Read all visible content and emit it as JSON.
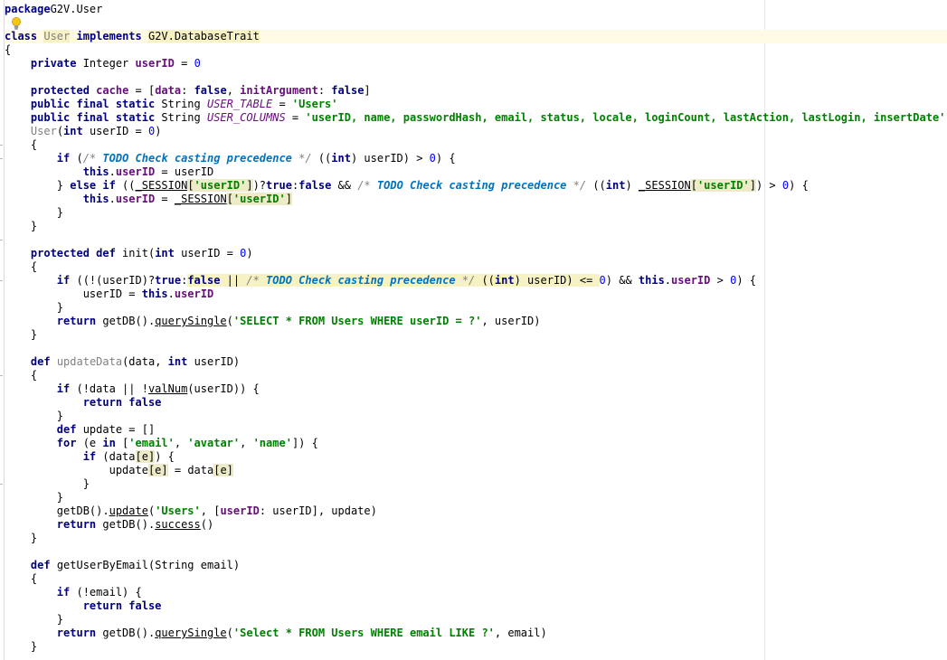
{
  "editor": {
    "language": "groovy",
    "colors": {
      "keyword": "#000080",
      "string": "#008000",
      "number": "#0000ff",
      "field": "#660e7a",
      "comment": "#808080",
      "todo": "#0073bf",
      "caret_line": "#fffae3",
      "highlight": "#edebc8"
    },
    "intention_icon": "lightbulb-icon",
    "lines": [
      [
        [
          "kw",
          "package"
        ],
        [
          "",
          "G2V.User"
        ]
      ],
      [],
      [
        [
          "kw",
          "class"
        ],
        [
          "",
          " "
        ],
        [
          "unu hlg",
          "User"
        ],
        [
          "",
          " "
        ],
        [
          "kw",
          "implements"
        ],
        [
          "",
          " "
        ],
        [
          "hlg",
          "G2V.DatabaseTrait"
        ]
      ],
      [
        [
          "",
          "{"
        ]
      ],
      [
        [
          "",
          "    "
        ],
        [
          "kw",
          "private"
        ],
        [
          "",
          " Integer "
        ],
        [
          "fld",
          "userID"
        ],
        [
          "",
          " = "
        ],
        [
          "num",
          "0"
        ]
      ],
      [],
      [
        [
          "",
          "    "
        ],
        [
          "kw",
          "protected"
        ],
        [
          "",
          " "
        ],
        [
          "fld",
          "cache"
        ],
        [
          "",
          " = ["
        ],
        [
          "fld",
          "data"
        ],
        [
          "",
          ": "
        ],
        [
          "kw",
          "false"
        ],
        [
          "",
          ", "
        ],
        [
          "fld",
          "initArgument"
        ],
        [
          "",
          ": "
        ],
        [
          "kw",
          "false"
        ],
        [
          "",
          "]"
        ]
      ],
      [
        [
          "",
          "    "
        ],
        [
          "kw",
          "public final static"
        ],
        [
          "",
          " String "
        ],
        [
          "cst",
          "USER_TABLE"
        ],
        [
          "",
          " = "
        ],
        [
          "str",
          "'Users'"
        ]
      ],
      [
        [
          "",
          "    "
        ],
        [
          "kw",
          "public final static"
        ],
        [
          "",
          " String "
        ],
        [
          "cst",
          "USER_COLUMNS"
        ],
        [
          "",
          " = "
        ],
        [
          "str",
          "'userID, name, passwordHash, email, status, locale, loginCount, lastAction, lastLogin, insertDate'"
        ]
      ],
      [
        [
          "",
          "    "
        ],
        [
          "unu",
          "User"
        ],
        [
          "",
          "("
        ],
        [
          "kw",
          "int"
        ],
        [
          "",
          " userID = "
        ],
        [
          "num",
          "0"
        ],
        [
          "",
          ")"
        ]
      ],
      [
        [
          "",
          "    {"
        ]
      ],
      [
        [
          "",
          "        "
        ],
        [
          "kw",
          "if"
        ],
        [
          "",
          " ("
        ],
        [
          "cmt",
          "/* "
        ],
        [
          "todo",
          "TODO Check casting precedence"
        ],
        [
          "cmt",
          " */"
        ],
        [
          "",
          " (("
        ],
        [
          "kw",
          "int"
        ],
        [
          "",
          ") userID) > "
        ],
        [
          "num",
          "0"
        ],
        [
          "",
          ") {"
        ]
      ],
      [
        [
          "",
          "            "
        ],
        [
          "kw",
          "this"
        ],
        [
          "",
          "."
        ],
        [
          "fld",
          "userID"
        ],
        [
          "",
          " = userID"
        ]
      ],
      [
        [
          "",
          "        } "
        ],
        [
          "kw",
          "else if"
        ],
        [
          "",
          " (("
        ],
        [
          "ul",
          "_SESSION"
        ],
        [
          "hl",
          "["
        ],
        [
          "str hl",
          "'userID'"
        ],
        [
          "hl",
          "]"
        ],
        [
          "",
          ")?"
        ],
        [
          "kw",
          "true"
        ],
        [
          "",
          ":"
        ],
        [
          "kw",
          "false"
        ],
        [
          "",
          " && "
        ],
        [
          "cmt",
          "/* "
        ],
        [
          "todo",
          "TODO Check casting precedence"
        ],
        [
          "cmt",
          " */"
        ],
        [
          "",
          " (("
        ],
        [
          "kw",
          "int"
        ],
        [
          "",
          ") "
        ],
        [
          "ul",
          "_SESSION"
        ],
        [
          "hl",
          "["
        ],
        [
          "str hl",
          "'userID'"
        ],
        [
          "hl",
          "]"
        ],
        [
          "",
          ") > "
        ],
        [
          "num",
          "0"
        ],
        [
          "",
          ") {"
        ]
      ],
      [
        [
          "",
          "            "
        ],
        [
          "kw",
          "this"
        ],
        [
          "",
          "."
        ],
        [
          "fld",
          "userID"
        ],
        [
          "",
          " = "
        ],
        [
          "ul",
          "_SESSION"
        ],
        [
          "hl",
          "["
        ],
        [
          "str hl",
          "'userID'"
        ],
        [
          "hl",
          "]"
        ]
      ],
      [
        [
          "",
          "        }"
        ]
      ],
      [
        [
          "",
          "    }"
        ]
      ],
      [],
      [
        [
          "",
          "    "
        ],
        [
          "kw",
          "protected def"
        ],
        [
          "",
          " init("
        ],
        [
          "kw",
          "int"
        ],
        [
          "",
          " userID = "
        ],
        [
          "num",
          "0"
        ],
        [
          "",
          ")"
        ]
      ],
      [
        [
          "",
          "    {"
        ]
      ],
      [
        [
          "",
          "        "
        ],
        [
          "kw",
          "if"
        ],
        [
          "",
          " ((!(userID)?"
        ],
        [
          "kw",
          "true"
        ],
        [
          "",
          ":"
        ],
        [
          "kw hlg",
          "false"
        ],
        [
          "hlg",
          " || "
        ],
        [
          "cmt hlg",
          "/* "
        ],
        [
          "todo hlg",
          "TODO Check casting precedence"
        ],
        [
          "cmt hlg",
          " */"
        ],
        [
          "hlg",
          " (("
        ],
        [
          "kw hlg",
          "int"
        ],
        [
          "hlg",
          ") userID) <= "
        ],
        [
          "num",
          "0"
        ],
        [
          "",
          ") && "
        ],
        [
          "kw",
          "this"
        ],
        [
          "",
          "."
        ],
        [
          "fld",
          "userID"
        ],
        [
          "",
          " > "
        ],
        [
          "num",
          "0"
        ],
        [
          "",
          ") {"
        ]
      ],
      [
        [
          "",
          "            userID = "
        ],
        [
          "kw",
          "this"
        ],
        [
          "",
          "."
        ],
        [
          "fld",
          "userID"
        ]
      ],
      [
        [
          "",
          "        }"
        ]
      ],
      [
        [
          "",
          "        "
        ],
        [
          "kw",
          "return"
        ],
        [
          "",
          " getDB()."
        ],
        [
          "ul",
          "querySingle"
        ],
        [
          "",
          "("
        ],
        [
          "str",
          "'SELECT * FROM Users WHERE userID = ?'"
        ],
        [
          "",
          ", userID)"
        ]
      ],
      [
        [
          "",
          "    }"
        ]
      ],
      [],
      [
        [
          "",
          "    "
        ],
        [
          "kw",
          "def"
        ],
        [
          "",
          " "
        ],
        [
          "unu",
          "updateData"
        ],
        [
          "",
          "(data, "
        ],
        [
          "kw",
          "int"
        ],
        [
          "",
          " userID)"
        ]
      ],
      [
        [
          "",
          "    {"
        ]
      ],
      [
        [
          "",
          "        "
        ],
        [
          "kw",
          "if"
        ],
        [
          "",
          " (!data || !"
        ],
        [
          "ul",
          "valNum"
        ],
        [
          "",
          "(userID)) {"
        ]
      ],
      [
        [
          "",
          "            "
        ],
        [
          "kw",
          "return false"
        ]
      ],
      [
        [
          "",
          "        }"
        ]
      ],
      [
        [
          "",
          "        "
        ],
        [
          "kw",
          "def"
        ],
        [
          "",
          " update = []"
        ]
      ],
      [
        [
          "",
          "        "
        ],
        [
          "kw",
          "for"
        ],
        [
          "",
          " (e "
        ],
        [
          "kw",
          "in"
        ],
        [
          "",
          " ["
        ],
        [
          "str",
          "'email'"
        ],
        [
          "",
          ", "
        ],
        [
          "str",
          "'avatar'"
        ],
        [
          "",
          ", "
        ],
        [
          "str",
          "'name'"
        ],
        [
          "",
          "]) {"
        ]
      ],
      [
        [
          "",
          "            "
        ],
        [
          "kw",
          "if"
        ],
        [
          "",
          " (data"
        ],
        [
          "hl",
          "[e]"
        ],
        [
          "",
          ") {"
        ]
      ],
      [
        [
          "",
          "                update"
        ],
        [
          "hl",
          "[e]"
        ],
        [
          "",
          " = data"
        ],
        [
          "hl",
          "[e]"
        ]
      ],
      [
        [
          "",
          "            }"
        ]
      ],
      [
        [
          "",
          "        }"
        ]
      ],
      [
        [
          "",
          "        getDB()."
        ],
        [
          "ul",
          "update"
        ],
        [
          "",
          "("
        ],
        [
          "str",
          "'Users'"
        ],
        [
          "",
          ", ["
        ],
        [
          "fld",
          "userID"
        ],
        [
          "",
          ": userID], update)"
        ]
      ],
      [
        [
          "",
          "        "
        ],
        [
          "kw",
          "return"
        ],
        [
          "",
          " getDB()."
        ],
        [
          "ul",
          "success"
        ],
        [
          "",
          "()"
        ]
      ],
      [
        [
          "",
          "    }"
        ]
      ],
      [],
      [
        [
          "",
          "    "
        ],
        [
          "kw",
          "def"
        ],
        [
          "",
          " getUserByEmail(String email)"
        ]
      ],
      [
        [
          "",
          "    {"
        ]
      ],
      [
        [
          "",
          "        "
        ],
        [
          "kw",
          "if"
        ],
        [
          "",
          " (!email) {"
        ]
      ],
      [
        [
          "",
          "            "
        ],
        [
          "kw",
          "return false"
        ]
      ],
      [
        [
          "",
          "        }"
        ]
      ],
      [
        [
          "",
          "        "
        ],
        [
          "kw",
          "return"
        ],
        [
          "",
          " getDB()."
        ],
        [
          "ul",
          "querySingle"
        ],
        [
          "",
          "("
        ],
        [
          "str",
          "'Select * FROM Users WHERE email LIKE ?'"
        ],
        [
          "",
          ", email)"
        ]
      ],
      [
        [
          "",
          "    }"
        ]
      ]
    ]
  }
}
